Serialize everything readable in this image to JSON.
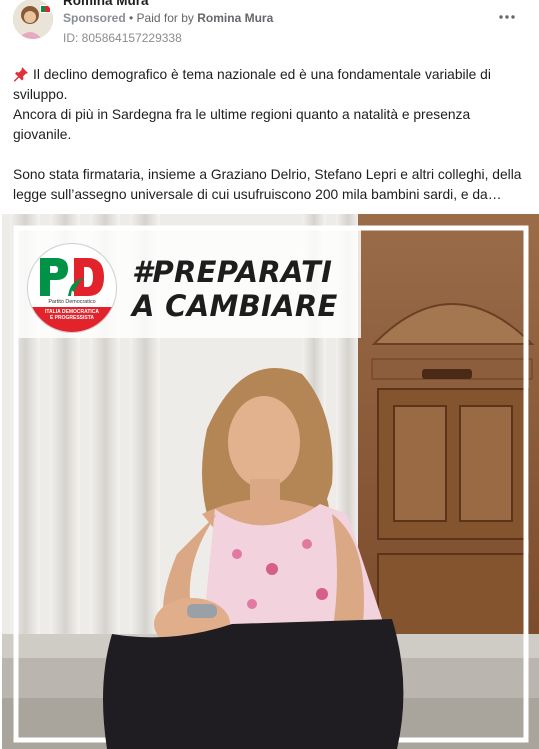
{
  "post": {
    "author": "Romina Mura",
    "sponsored_label": "Sponsored",
    "separator": " • ",
    "paid_for_prefix": "Paid for by ",
    "paid_for_name": "Romina Mura",
    "ad_id": "ID: 805864157229338",
    "more_icon": "ellipsis-icon",
    "text_line_1": "Il declino demografico è tema nazionale ed è una fondamentale variabile di sviluppo.",
    "text_line_2": "Ancora di più in Sardegna fra le ultime regioni quanto a natalità e presenza giovanile.",
    "text_line_3": "Sono stata firmataria, insieme a Graziano Delrio, Stefano Lepri e altri colleghi, della legge sull’assegno universale di cui usufruiscono 200 mila bambini sardi, e da…"
  },
  "creative": {
    "hashtag_line_1": "#PREPARATI",
    "hashtag_line_2": "A CAMBIARE",
    "logo_letters": "PD",
    "logo_party_name": "Partito Democratico",
    "logo_band_line_1": "ITALIA DEMOCRATICA",
    "logo_band_line_2": "E PROGRESSISTA"
  },
  "colors": {
    "pd_green": "#009246",
    "pd_red": "#e2232b",
    "door_brown": "#8a5a36",
    "text_secondary": "#65676b"
  }
}
